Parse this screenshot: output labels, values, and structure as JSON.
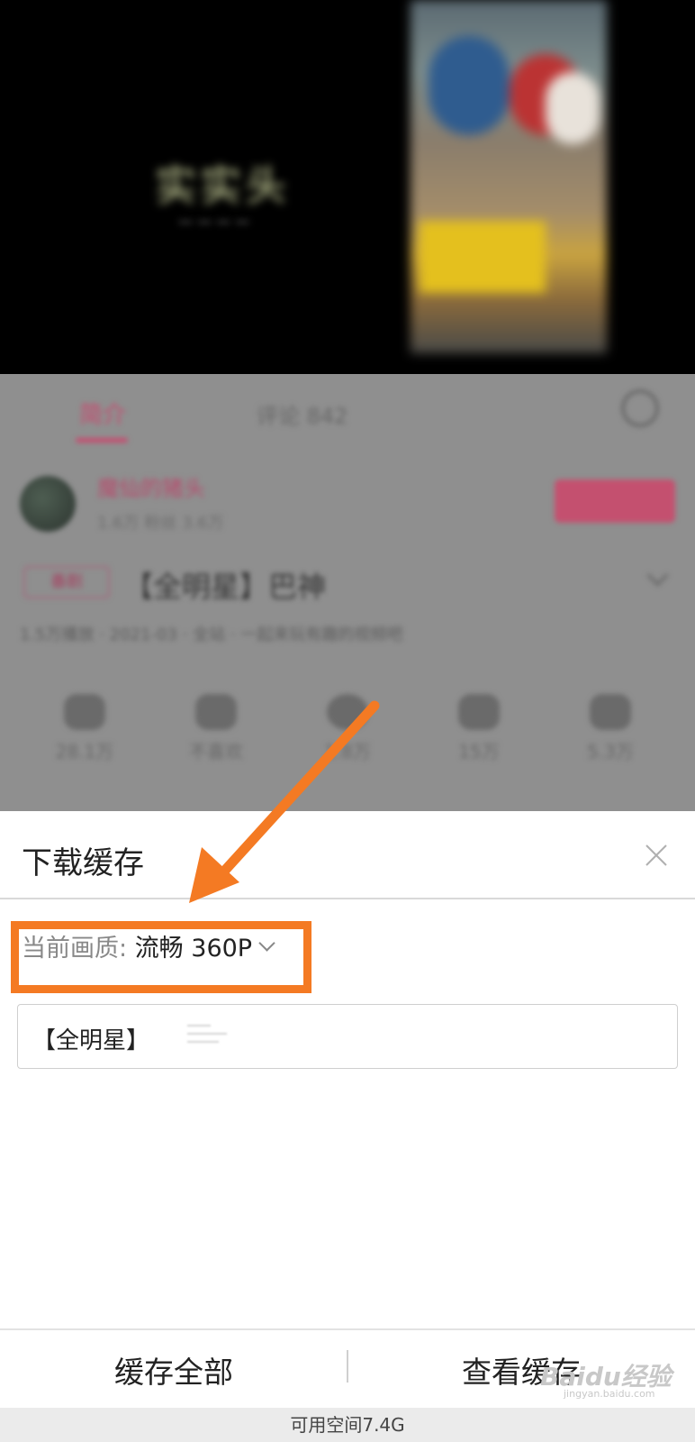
{
  "background_page": {
    "video_title": "实实头",
    "tabs": [
      {
        "label": "简介"
      },
      {
        "label": "评论 842"
      }
    ],
    "uploader_name": "魔仙的猪头",
    "uploader_meta": "1.6万 粉丝 3.6万",
    "video_tag": "番剧",
    "video_title_line": "【全明星】巴神",
    "video_desc": "1.5万播放 · 2021-03 · 全站 · 一起来玩有趣的视频吧",
    "stats": [
      {
        "label": "28.1万"
      },
      {
        "label": "不喜欢"
      },
      {
        "label": "1.8万"
      },
      {
        "label": "15万"
      },
      {
        "label": "5.3万"
      }
    ]
  },
  "sheet": {
    "title": "下载缓存",
    "quality_label": "当前画质: ",
    "quality_value": "流畅 360P",
    "episode_label": "【全明星】",
    "cache_all_label": "缓存全部",
    "view_cache_label": "查看缓存",
    "storage_text": "可用空间7.4G"
  },
  "watermark": {
    "brand": "Baidu经验",
    "sub": "jingyan.baidu.com"
  },
  "colors": {
    "highlight": "#f47a23",
    "accent_pink": "#c9486e"
  }
}
